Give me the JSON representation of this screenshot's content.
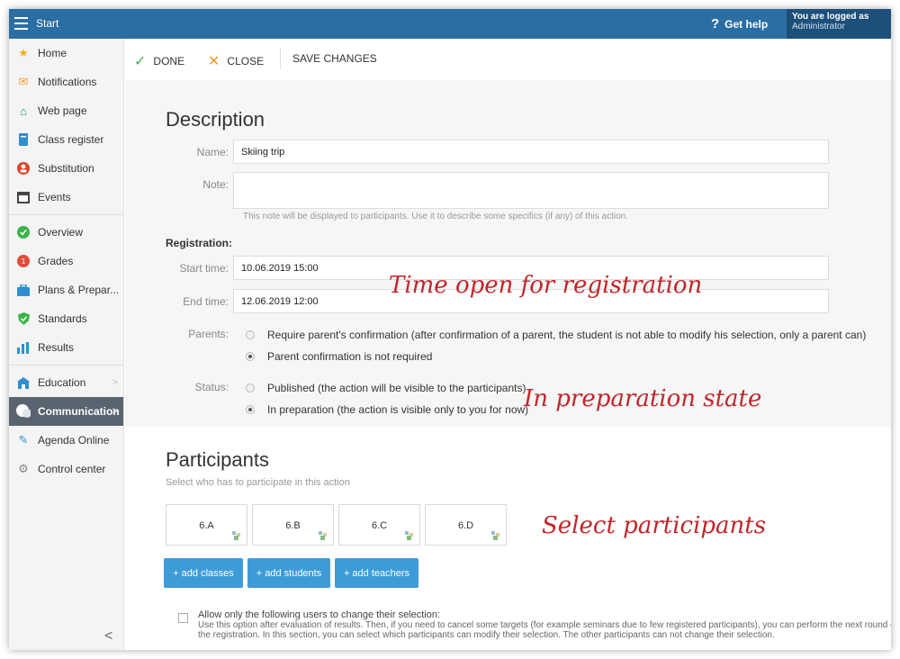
{
  "topbar": {
    "title": "Start",
    "help": "Get help",
    "logged_line1": "You are logged as",
    "logged_line2": "Administrator"
  },
  "sidebar": {
    "items": [
      {
        "label": "Home"
      },
      {
        "label": "Notifications"
      },
      {
        "label": "Web page"
      },
      {
        "label": "Class register"
      },
      {
        "label": "Substitution"
      },
      {
        "label": "Events"
      },
      {
        "label": "Overview"
      },
      {
        "label": "Grades"
      },
      {
        "label": "Plans & Prepar..."
      },
      {
        "label": "Standards"
      },
      {
        "label": "Results"
      },
      {
        "label": "Education"
      },
      {
        "label": "Communication"
      },
      {
        "label": "Agenda Online"
      },
      {
        "label": "Control center"
      }
    ]
  },
  "toolbar": {
    "done": "DONE",
    "close": "CLOSE",
    "save": "SAVE CHANGES"
  },
  "description": {
    "heading": "Description",
    "name_label": "Name:",
    "name_value": "Skiing trip",
    "note_label": "Note:",
    "note_value": "",
    "note_hint": "This note will be displayed to participants. Use it to describe some specifics (if any) of this action.",
    "registration_label": "Registration:",
    "start_label": "Start time:",
    "start_value": "10.06.2019 15:00",
    "end_label": "End time:",
    "end_value": "12.06.2019 12:00",
    "parents_label": "Parents:",
    "parents_opt1": "Require parent's confirmation (after confirmation of a parent, the student is not able to modify his selection, only a parent can)",
    "parents_opt2": "Parent confirmation is not required",
    "status_label": "Status:",
    "status_opt1": "Published (the action will be visible to the participants)",
    "status_opt2": "In preparation (the action is visible only to you for now)"
  },
  "annotations": {
    "time": "Time open for registration",
    "prep": "In preparation state",
    "participants": "Select participants"
  },
  "participants": {
    "heading": "Participants",
    "subtitle": "Select who has to participate in this action",
    "classes": [
      "6.A",
      "6.B",
      "6.C",
      "6.D"
    ],
    "add_classes": "+ add classes",
    "add_students": "+ add students",
    "add_teachers": "+ add teachers",
    "allow_label": "Allow only the following users to change their selection:",
    "allow_hint": "Use this option after evaluation of results. Then, if you need to cancel some targets (for example seminars due to few registered participants), you can perform the next round of the registration. In this section, you can select which participants can modify their selection. The other participants can not change their selection."
  }
}
